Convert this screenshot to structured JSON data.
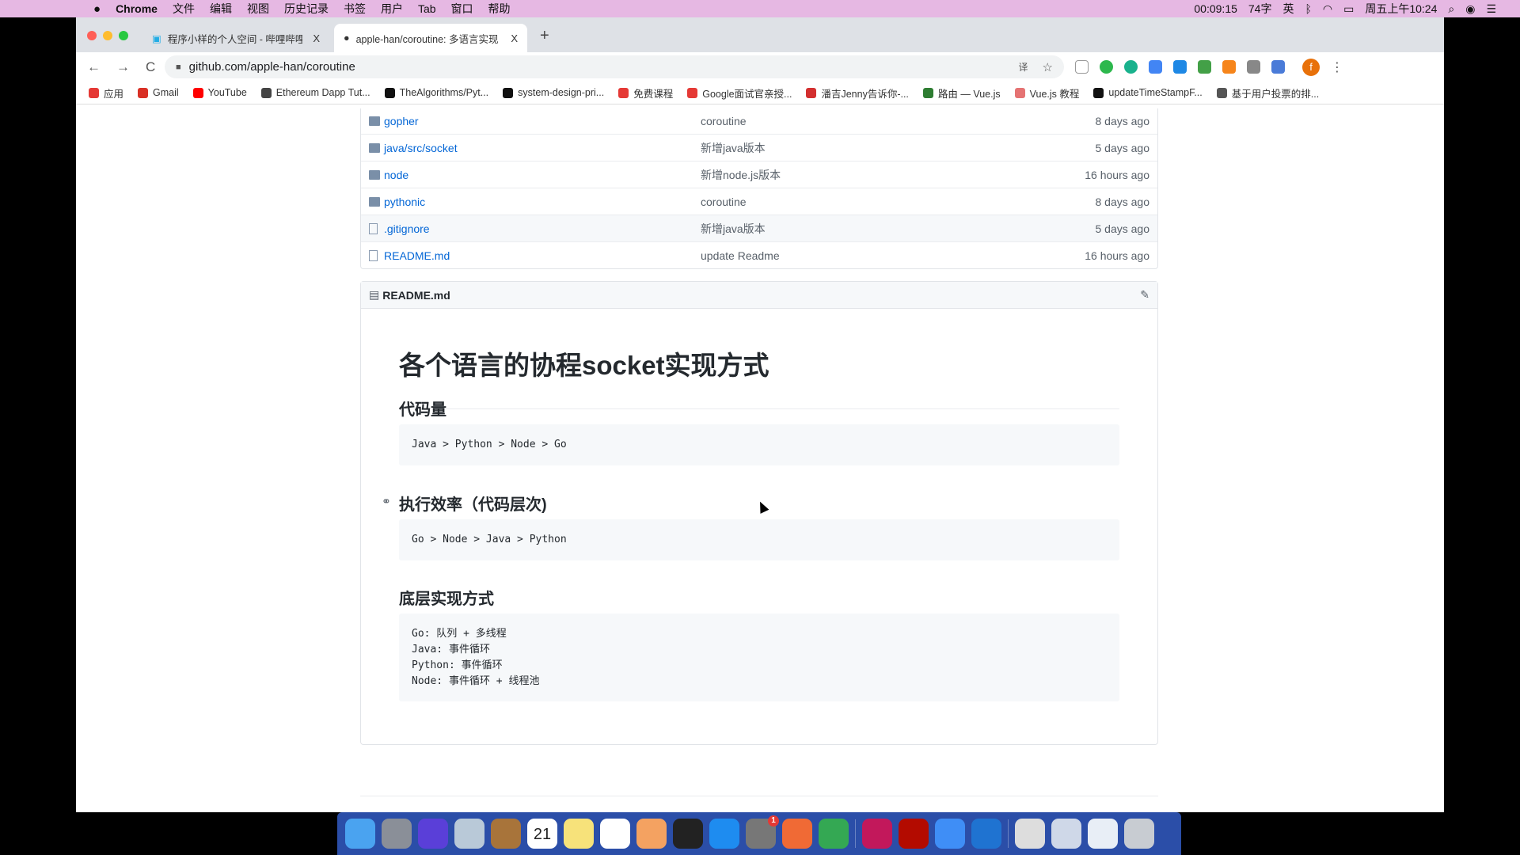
{
  "menubar": {
    "apple": "",
    "app": "Chrome",
    "items": [
      "文件",
      "编辑",
      "视图",
      "历史记录",
      "书签",
      "用户",
      "Tab",
      "窗口",
      "帮助"
    ],
    "status": {
      "recording": "00:09:15",
      "wordcount": "74字",
      "ime": "英",
      "clock": "周五上午10:24"
    }
  },
  "tabs": [
    {
      "title": "程序小样的个人空间 - 哔哩哔哩",
      "close": "X"
    },
    {
      "title": "apple-han/coroutine: 多语言实现",
      "close": "X"
    }
  ],
  "new_tab": "+",
  "toolbar": {
    "back": "←",
    "forward": "→",
    "reload": "C",
    "url": "github.com/apple-han/coroutine",
    "translate": "译",
    "star": "☆",
    "menu": "⋮",
    "avatar": "f"
  },
  "bookmarks": [
    {
      "label": "应用",
      "color": "#e53935"
    },
    {
      "label": "Gmail",
      "color": "#d93025"
    },
    {
      "label": "YouTube",
      "color": "#ff0000"
    },
    {
      "label": "Ethereum Dapp Tut...",
      "color": "#444"
    },
    {
      "label": "TheAlgorithms/Pyt...",
      "color": "#111"
    },
    {
      "label": "system-design-pri...",
      "color": "#111"
    },
    {
      "label": "免费课程",
      "color": "#e53935"
    },
    {
      "label": "Google面试官亲授...",
      "color": "#e53935"
    },
    {
      "label": "潘吉Jenny告诉你-...",
      "color": "#d32f2f"
    },
    {
      "label": "路由 — Vue.js",
      "color": "#2e7d32"
    },
    {
      "label": "Vue.js 教程",
      "color": "#e57373"
    },
    {
      "label": "updateTimeStampF...",
      "color": "#111"
    },
    {
      "label": "基于用户投票的排...",
      "color": "#555"
    }
  ],
  "files": [
    {
      "name": "gopher",
      "type": "folder",
      "message": "coroutine",
      "age": "8 days ago"
    },
    {
      "name": "java/src/socket",
      "type": "folder",
      "message": "新增java版本",
      "age": "5 days ago"
    },
    {
      "name": "node",
      "type": "folder",
      "message": "新增node.js版本",
      "age": "16 hours ago"
    },
    {
      "name": "pythonic",
      "type": "folder",
      "message": "coroutine",
      "age": "8 days ago"
    },
    {
      "name": ".gitignore",
      "type": "file",
      "message": "新增java版本",
      "age": "5 days ago"
    },
    {
      "name": "README.md",
      "type": "file",
      "message": "update Readme",
      "age": "16 hours ago"
    }
  ],
  "readme": {
    "header": "README.md",
    "edit_icon": "pencil-icon",
    "title": "各个语言的协程socket实现方式",
    "sections": [
      {
        "heading": "代码量",
        "code": "Java > Python > Node > Go"
      },
      {
        "heading": "执行效率（代码层次)",
        "code": "Go > Node > Java > Python"
      },
      {
        "heading": "底层实现方式",
        "code": "Go: 队列 + 多线程\nJava: 事件循环\nPython: 事件循环\nNode: 事件循环 + 线程池"
      }
    ]
  },
  "dock": {
    "apps": [
      "Finder",
      "Launchpad",
      "Siri",
      "Mail",
      "Contacts",
      "Calendar",
      "Notes",
      "Reminders",
      "Photos",
      "Terminal",
      "App Store",
      "System Preferences",
      "Postman",
      "Chrome",
      "IntelliJ IDEA",
      "Acrobat",
      "Paw",
      "Keynote",
      "Window 1",
      "Window 2",
      "Window 3",
      "Trash"
    ],
    "calendar_day": "21",
    "badge": "1"
  }
}
